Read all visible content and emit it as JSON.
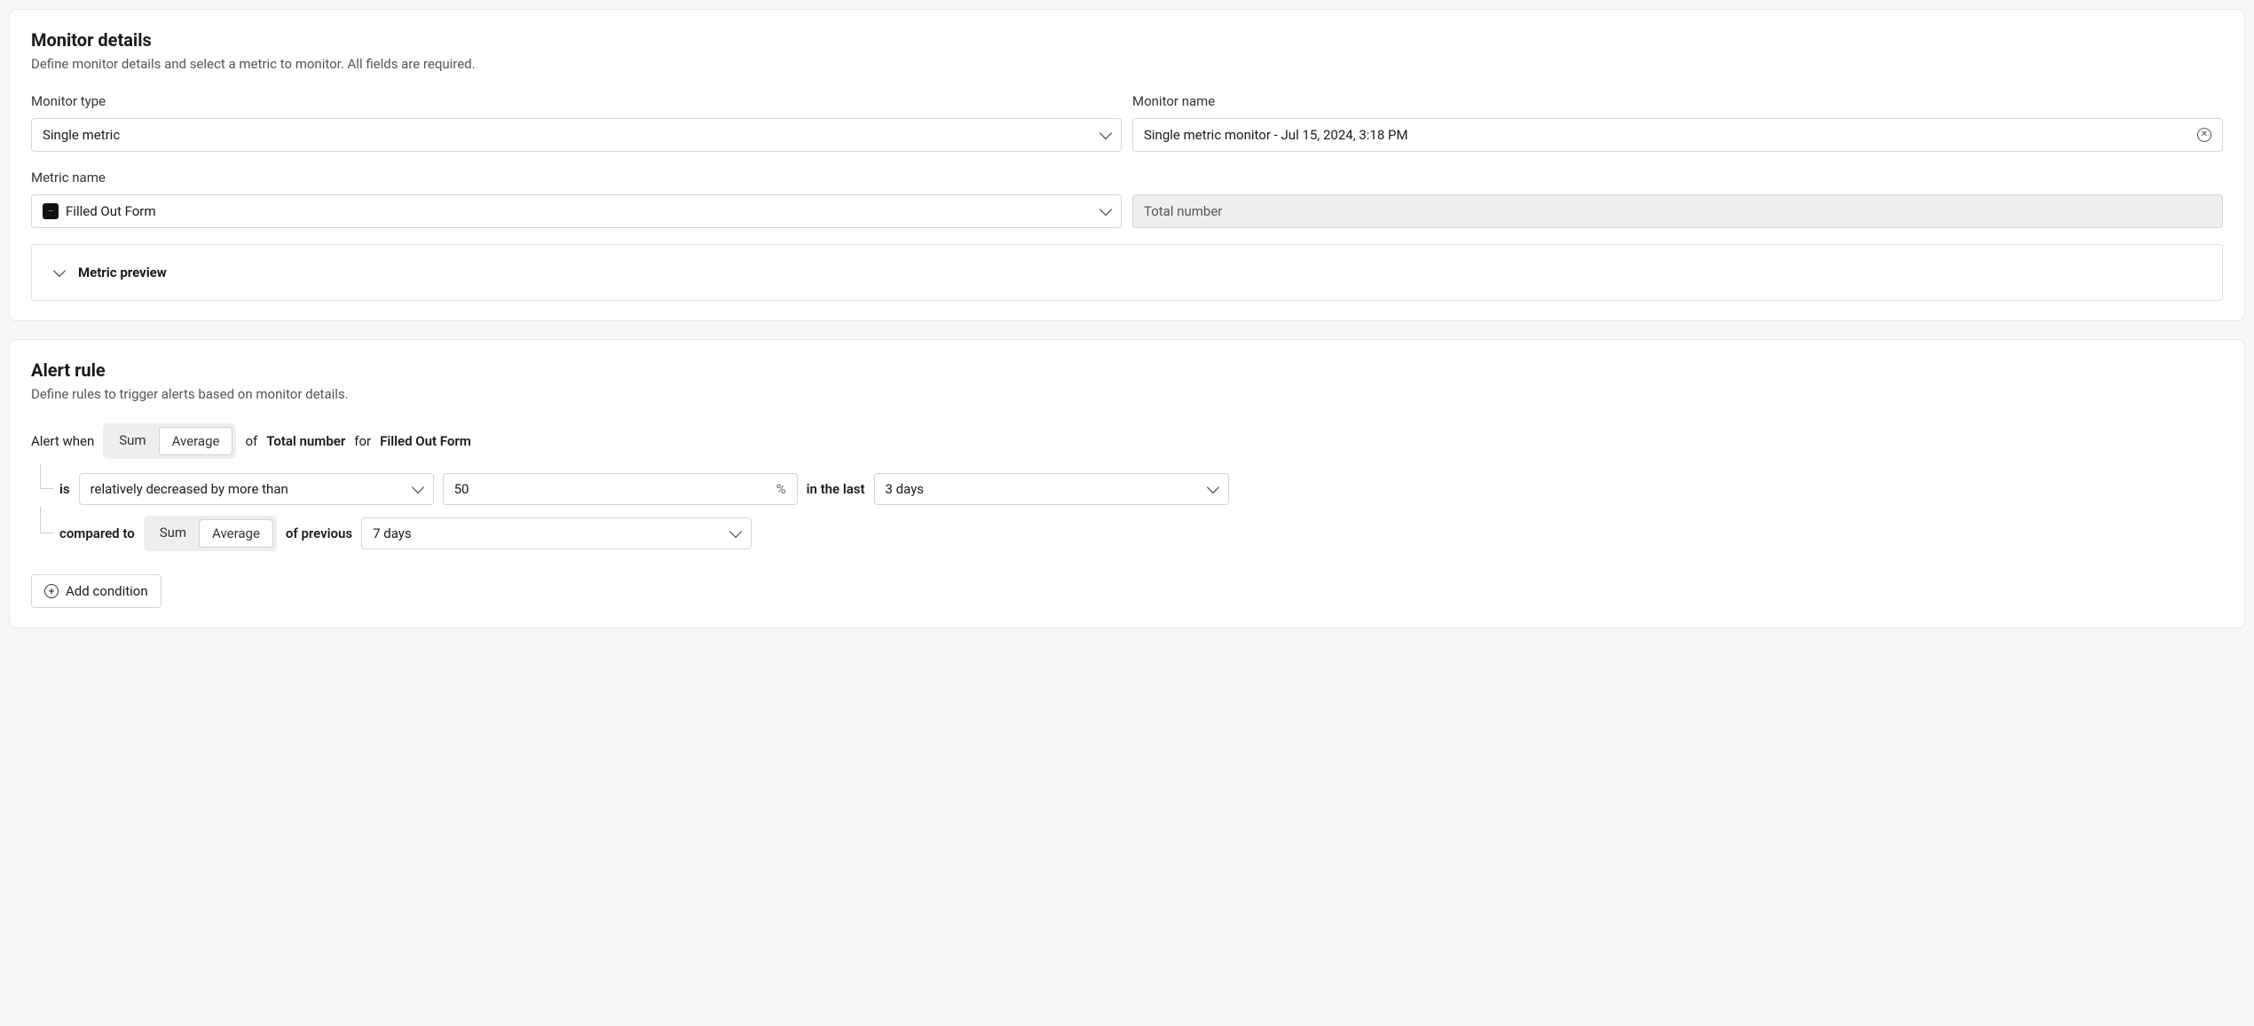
{
  "monitor_details": {
    "title": "Monitor details",
    "subtitle": "Define monitor details and select a metric to monitor. All fields are required.",
    "monitor_type_label": "Monitor type",
    "monitor_type_value": "Single metric",
    "monitor_name_label": "Monitor name",
    "monitor_name_value": "Single metric monitor - Jul 15, 2024, 3:18 PM",
    "metric_name_label": "Metric name",
    "metric_name_value": "Filled Out Form",
    "aggregation_value": "Total number",
    "preview_label": "Metric preview"
  },
  "alert_rule": {
    "title": "Alert rule",
    "subtitle": "Define rules to trigger alerts based on monitor details.",
    "alert_when": "Alert when",
    "seg_sum": "Sum",
    "seg_average": "Average",
    "of": "of",
    "total_number": "Total number",
    "for": "for",
    "metric": "Filled Out Form",
    "is": "is",
    "comparison_value": "relatively decreased by more than",
    "threshold_value": "50",
    "threshold_suffix": "%",
    "in_the_last": "in the last",
    "window_value": "3 days",
    "compared_to": "compared to",
    "seg2_sum": "Sum",
    "seg2_average": "Average",
    "of_previous": "of previous",
    "baseline_value": "7 days",
    "add_condition": "Add condition"
  }
}
